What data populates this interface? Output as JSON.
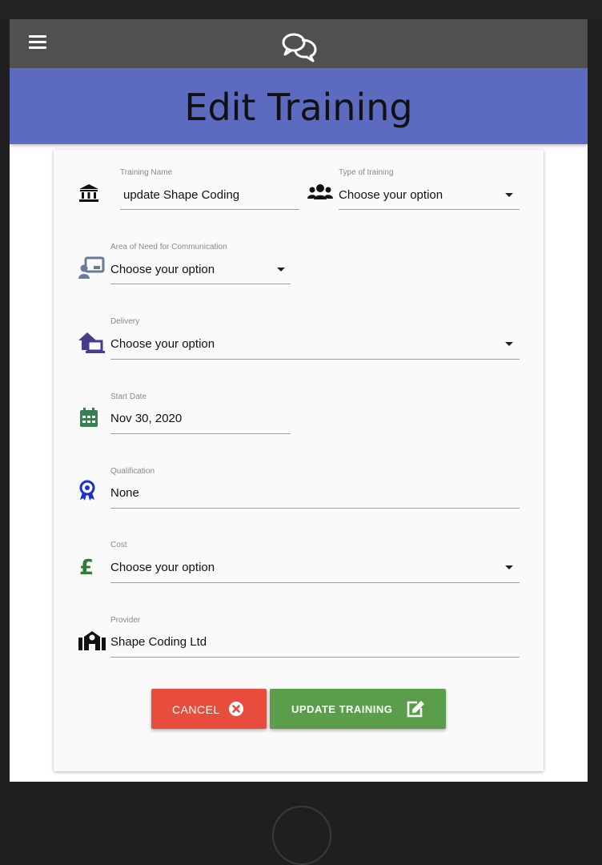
{
  "header": {
    "title": "Edit Training"
  },
  "nav": {
    "menu_icon": "hamburger-menu-icon",
    "logo_icon": "chat-bubbles-icon"
  },
  "form": {
    "training_name": {
      "label": "Training Name",
      "value": "update Shape Coding",
      "icon": "bank-icon"
    },
    "type_of_training": {
      "label": "Type of training",
      "value": "Choose your option",
      "icon": "users-icon"
    },
    "area_of_need": {
      "label": "Area of Need for Communication",
      "value": "Choose your option",
      "icon": "presentation-user-icon"
    },
    "delivery": {
      "label": "Delivery",
      "value": "Choose your option",
      "icon": "home-laptop-icon"
    },
    "start_date": {
      "label": "Start Date",
      "value": "Nov 30, 2020",
      "icon": "calendar-icon"
    },
    "qualification": {
      "label": "Qualification",
      "value": "None",
      "icon": "award-ribbon-icon"
    },
    "cost": {
      "label": "Cost",
      "value": "Choose your option",
      "icon": "pound-sign-icon"
    },
    "provider": {
      "label": "Provider",
      "value": "Shape Coding Ltd",
      "icon": "school-icon"
    }
  },
  "buttons": {
    "cancel": {
      "label": "CANCEL",
      "icon": "times-circle-icon"
    },
    "update": {
      "label": "UPDATE TRAINING",
      "icon": "edit-icon"
    }
  },
  "colors": {
    "topbar": "#505050",
    "banner": "#5c6bc0",
    "cancel": "#e74c3c",
    "update": "#5a9e4b",
    "calendar_icon": "#3b7d55",
    "award_icon": "#1a2fd6",
    "pound_icon": "#2e7d32",
    "delivery_icon": "#4a3b8c"
  }
}
